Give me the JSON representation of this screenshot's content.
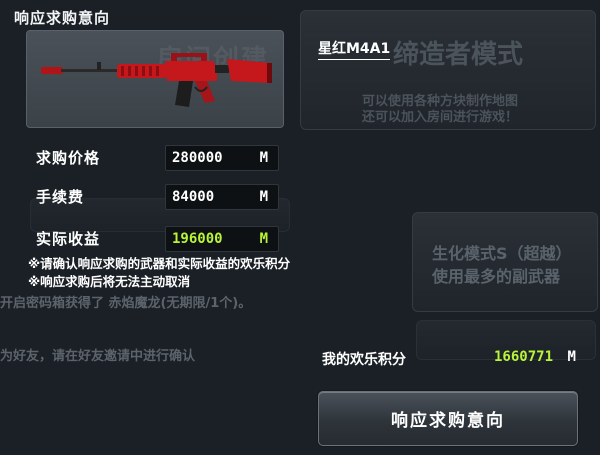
{
  "dialog": {
    "title": "响应求购意向",
    "weapon_name": "星红M4A1"
  },
  "rows": [
    {
      "label": "求购价格",
      "value": "280000",
      "unit": "M",
      "color": "#ffffff"
    },
    {
      "label": "手续费",
      "value": "84000",
      "unit": "M",
      "color": "#ffffff"
    },
    {
      "label": "实际收益",
      "value": "196000",
      "unit": "M",
      "color": "#b9f43a"
    }
  ],
  "notes": [
    "※请确认响应求购的武器和实际收益的欢乐积分",
    "※响应求购后将无法主动取消"
  ],
  "points": {
    "label": "我的欢乐积分",
    "value": "1660771",
    "unit": "M"
  },
  "confirm_button": {
    "label": "响应求购意向"
  },
  "background": {
    "mode_title": "缔造者模式",
    "mode_desc_1": "可以使用各种方块制作地图",
    "mode_desc_2": "还可以加入房间进行游戏！",
    "bio_mode_1": "生化模式S（超越）",
    "bio_mode_2": "使用最多的副武器",
    "reward_text": "开启密码箱获得了 赤焰魔龙(无期限/1个)。",
    "friend_text": "为好友，请在好友邀请中进行确认",
    "ghost_text": "房间创建"
  },
  "colors": {
    "accent_green": "#b9f43a",
    "weapon_red": "#c4181d"
  }
}
